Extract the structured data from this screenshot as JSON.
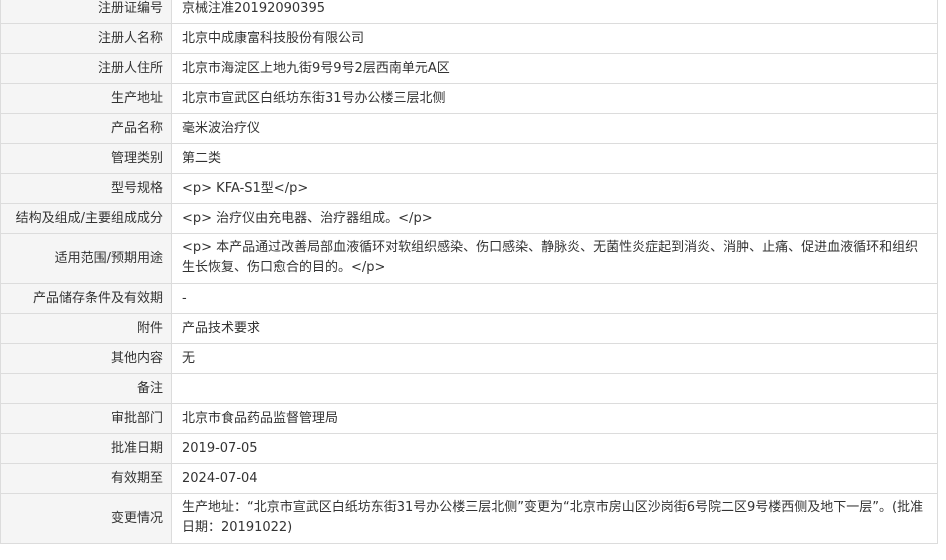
{
  "rows": [
    {
      "label": "注册证编号",
      "value": "京械注准20192090395"
    },
    {
      "label": "注册人名称",
      "value": "北京中成康富科技股份有限公司"
    },
    {
      "label": "注册人住所",
      "value": "北京市海淀区上地九街9号9号2层西南单元A区"
    },
    {
      "label": "生产地址",
      "value": "北京市宣武区白纸坊东街31号办公楼三层北侧"
    },
    {
      "label": "产品名称",
      "value": "毫米波治疗仪"
    },
    {
      "label": "管理类别",
      "value": "第二类"
    },
    {
      "label": "型号规格",
      "value": "<p> KFA-S1型</p>"
    },
    {
      "label": "结构及组成/主要组成成分",
      "value": "<p> 治疗仪由充电器、治疗器组成。</p>"
    },
    {
      "label": "适用范围/预期用途",
      "value": "<p> 本产品通过改善局部血液循环对软组织感染、伤口感染、静脉炎、无菌性炎症起到消炎、消肿、止痛、促进血液循环和组织生长恢复、伤口愈合的目的。</p>"
    },
    {
      "label": "产品储存条件及有效期",
      "value": "-"
    },
    {
      "label": "附件",
      "value": "产品技术要求"
    },
    {
      "label": "其他内容",
      "value": "无"
    },
    {
      "label": "备注",
      "value": ""
    },
    {
      "label": "审批部门",
      "value": "北京市食品药品监督管理局"
    },
    {
      "label": "批准日期",
      "value": "2019-07-05"
    },
    {
      "label": "有效期至",
      "value": "2024-07-04"
    },
    {
      "label": "变更情况",
      "value": "生产地址：“北京市宣武区白纸坊东街31号办公楼三层北侧”变更为“北京市房山区沙岗街6号院二区9号楼西侧及地下一层”。(批准日期：20191022)"
    }
  ]
}
